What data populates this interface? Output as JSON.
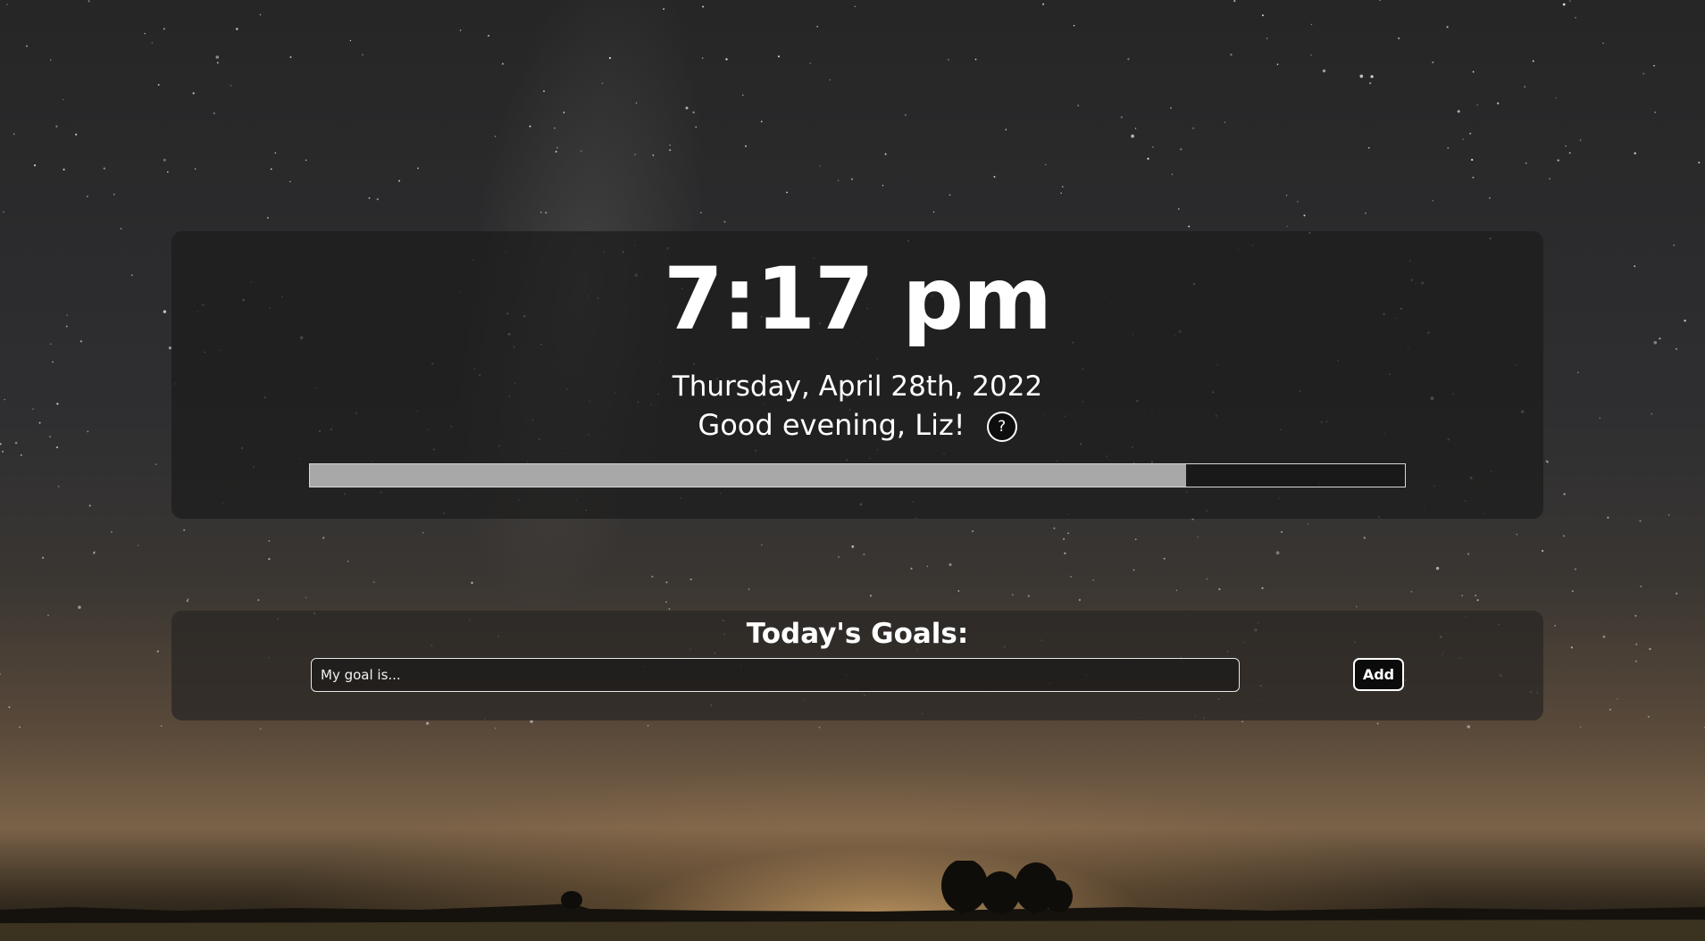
{
  "background": {
    "scene": "night-sky-with-stars-over-field",
    "sky_color": "#2b2b2d",
    "horizon_glow_color": "#f5c37a"
  },
  "clock": {
    "time": "7:17 pm",
    "date": "Thursday, April 28th, 2022",
    "greeting": "Good evening, Liz!",
    "help_label": "?",
    "help_icon": "question-mark-icon",
    "day_progress": 0.8,
    "progress_fill_color": "#a8a8a8"
  },
  "goals": {
    "title": "Today's Goals:",
    "input_placeholder": "My goal is...",
    "input_value": "",
    "add_label": "Add"
  }
}
